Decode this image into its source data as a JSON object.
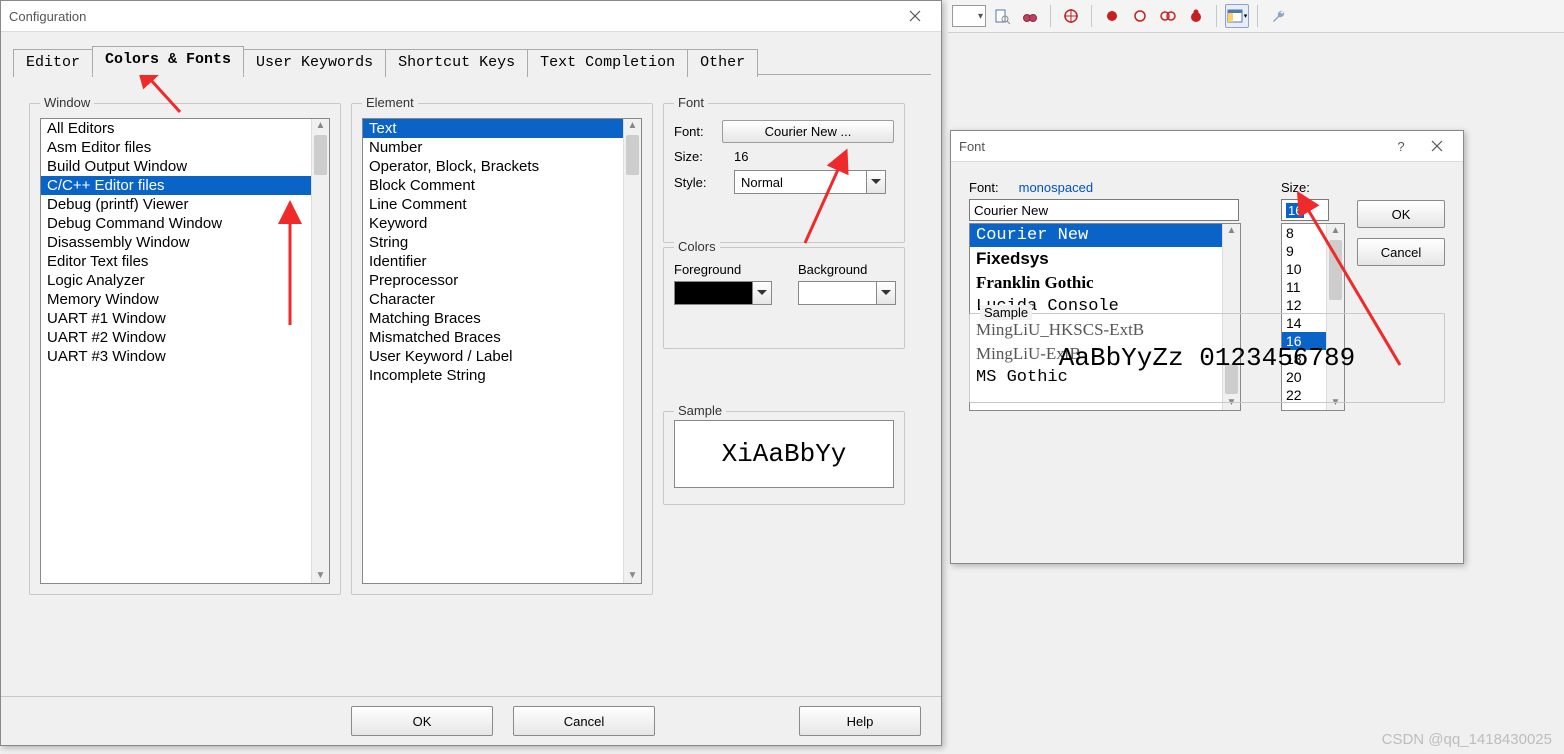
{
  "toolbar": {
    "icons": [
      "dropdown",
      "doc-search",
      "binoculars",
      "sep",
      "target",
      "sep",
      "record-red",
      "record-hollow",
      "linked-circles",
      "bug-red",
      "sep",
      "layout-toggle",
      "sep",
      "wrench"
    ]
  },
  "config": {
    "title": "Configuration",
    "tabs": [
      "Editor",
      "Colors & Fonts",
      "User Keywords",
      "Shortcut Keys",
      "Text Completion",
      "Other"
    ],
    "active_tab_index": 1,
    "window_group": {
      "legend": "Window",
      "items": [
        "All Editors",
        "Asm Editor files",
        "Build Output Window",
        "C/C++ Editor files",
        "Debug (printf) Viewer",
        "Debug Command Window",
        "Disassembly Window",
        "Editor Text files",
        "Logic Analyzer",
        "Memory Window",
        "UART #1 Window",
        "UART #2 Window",
        "UART #3 Window"
      ],
      "selected_index": 3
    },
    "element_group": {
      "legend": "Element",
      "items": [
        "Text",
        "Number",
        "Operator, Block, Brackets",
        "Block Comment",
        "Line Comment",
        "Keyword",
        "String",
        "Identifier",
        "Preprocessor",
        "Character",
        "Matching Braces",
        "Mismatched Braces",
        "User Keyword / Label",
        "Incomplete String"
      ],
      "selected_index": 0
    },
    "font_group": {
      "legend": "Font",
      "font_label": "Font:",
      "font_button": "Courier New ...",
      "size_label": "Size:",
      "size_value": "16",
      "style_label": "Style:",
      "style_value": "Normal"
    },
    "colors_group": {
      "legend": "Colors",
      "fg_label": "Foreground",
      "bg_label": "Background",
      "fg_color": "#000000",
      "bg_color": "#ffffff"
    },
    "sample_group": {
      "legend": "Sample",
      "text": "XiAaBbYy"
    },
    "buttons": {
      "ok": "OK",
      "cancel": "Cancel",
      "help": "Help"
    }
  },
  "fontdlg": {
    "title": "Font",
    "help_icon": "?",
    "font_label": "Font:",
    "font_hint": "monospaced",
    "font_value": "Courier New",
    "size_label": "Size:",
    "size_value": "16",
    "font_list": [
      {
        "name": "Courier New",
        "cls": "mono",
        "selected": true
      },
      {
        "name": "Fixedsys",
        "cls": "sans"
      },
      {
        "name": "Franklin Gothic",
        "cls": "serif"
      },
      {
        "name": "Lucida Console",
        "cls": "mono"
      },
      {
        "name": "MingLiU_HKSCS-ExtB",
        "cls": "simsun"
      },
      {
        "name": "MingLiU-ExtB",
        "cls": "simsun"
      },
      {
        "name": "MS Gothic",
        "cls": "gothic"
      }
    ],
    "size_list": [
      "8",
      "9",
      "10",
      "11",
      "12",
      "14",
      "16",
      "18",
      "20",
      "22"
    ],
    "size_selected": "16",
    "ok": "OK",
    "cancel": "Cancel",
    "sample_legend": "Sample",
    "sample_text": "AaBbYyZz 0123456789"
  },
  "watermark": "CSDN @qq_1418430025"
}
